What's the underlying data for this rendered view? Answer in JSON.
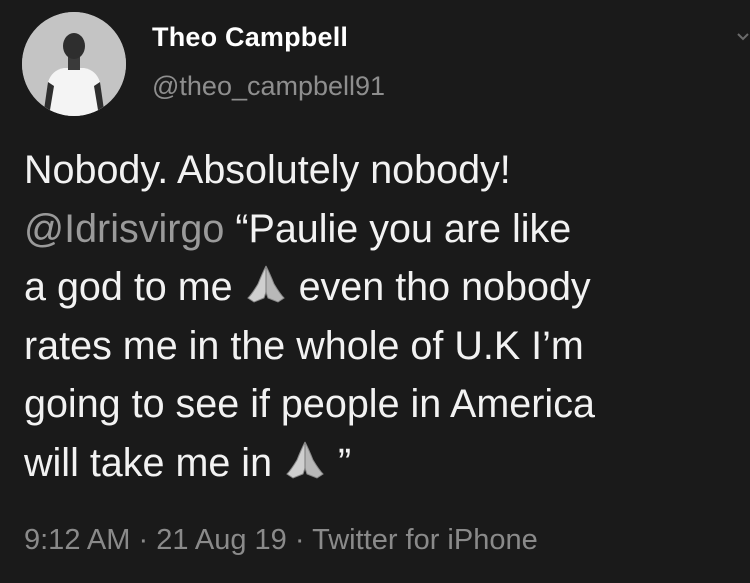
{
  "user": {
    "name": "Theo Campbell",
    "handle": "@theo_campbell91"
  },
  "tweet": {
    "line1": "Nobody. Absolutely nobody!",
    "line2_mention": "@Idrisvirgo",
    "line2_rest": " “Paulie you are like",
    "line3_before": "a god to me ",
    "line3_after": " even tho nobody",
    "line4": "rates me in the whole of U.K I’m",
    "line5": "going to see if people in America",
    "line6_before": "will take me in ",
    "line6_after": " ”"
  },
  "meta": {
    "time": "9:12 AM",
    "sep1": " · ",
    "date": "21 Aug 19",
    "sep2": " · ",
    "source": "Twitter for iPhone"
  },
  "icons": {
    "emoji": "folded-hands-icon",
    "menu": "chevron-down-icon"
  }
}
